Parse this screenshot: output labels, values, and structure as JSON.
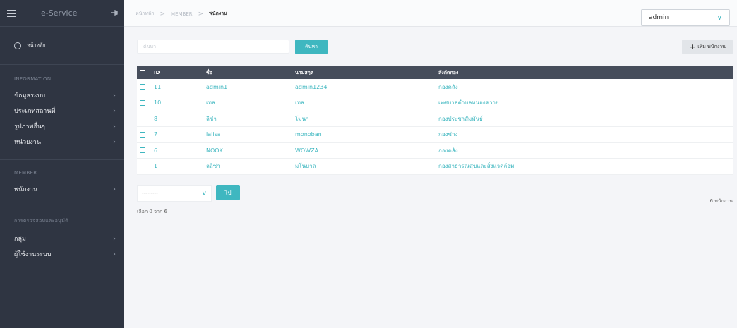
{
  "sidebar": {
    "app_name": "e-Service",
    "home_label": "หน้าหลัก",
    "sections": [
      {
        "title": "INFORMATION",
        "items": [
          "ข้อมูลระบบ",
          "ประเภทสถานที่",
          "รูปภาพอื่นๆ",
          "หน่วยงาน"
        ]
      },
      {
        "title": "MEMBER",
        "items": [
          "พนักงาน"
        ]
      },
      {
        "title": "การตรวจสอบและอนุมัติ",
        "items": [
          "กลุ่ม",
          "ผู้ใช้งานระบบ"
        ]
      }
    ],
    "chevron": "›"
  },
  "header": {
    "breadcrumb": [
      "หน้าหลัก",
      "MEMBER",
      "พนักงาน"
    ],
    "separator": ">",
    "user": "admin",
    "user_chevron": "∨"
  },
  "toolbar": {
    "search_placeholder": "ค้นหา",
    "search_button": "ค้นหา",
    "add_button": "เพิ่ม พนักงาน",
    "add_icon": "+"
  },
  "table": {
    "columns": [
      "ID",
      "ชื่อ",
      "นามสกุล",
      "สังกัดกอง"
    ],
    "rows": [
      {
        "id": "11",
        "first": "admin1",
        "last": "admin1234",
        "dept": "กองคลัง"
      },
      {
        "id": "10",
        "first": "เทส",
        "last": "เทส",
        "dept": "เทศบาลตำบลหนองควาย"
      },
      {
        "id": "8",
        "first": "ลิซ่า",
        "last": "โมนา",
        "dept": "กองประชาสัมพันธ์"
      },
      {
        "id": "7",
        "first": "lalisa",
        "last": "monoban",
        "dept": "กองช่าง"
      },
      {
        "id": "6",
        "first": "NOOK",
        "last": "WOWZA",
        "dept": "กองคลัง"
      },
      {
        "id": "1",
        "first": "ลลิซ่า",
        "last": "มโนบาล",
        "dept": "กองสาธารณสุขและสิ่งแวดล้อม"
      }
    ]
  },
  "footer": {
    "bulk_action_value": "---------",
    "bulk_chevron": "∨",
    "go_button": "ไป",
    "selected_text": "เลือก 0 จาก 6",
    "count_text": "6 พนักงาน"
  },
  "colors": {
    "accent": "#3fb7c0",
    "sidebar_bg": "#2f3542",
    "table_header_bg": "#464d5b"
  }
}
